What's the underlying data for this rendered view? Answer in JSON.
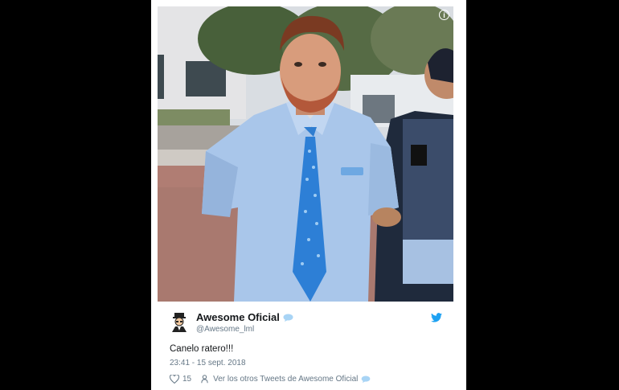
{
  "tweet": {
    "display_name": "Awesome Oficial",
    "handle": "@Awesome_lml",
    "text": "Canelo ratero!!!",
    "timestamp": "23:41 - 15 sept. 2018",
    "likes": "15",
    "see_more": "Ver los otros Tweets de Awesome Oficial"
  },
  "media": {
    "info_icon_glyph": "i"
  },
  "icons": {
    "verified": "speech-bubble-icon",
    "brand": "twitter-bird-icon",
    "like": "heart-icon",
    "profile": "person-icon",
    "avatar": "cartoon-avatar"
  },
  "colors": {
    "brand": "#1da1f2",
    "text": "#14171a",
    "muted": "#657786",
    "background": "#000000"
  }
}
